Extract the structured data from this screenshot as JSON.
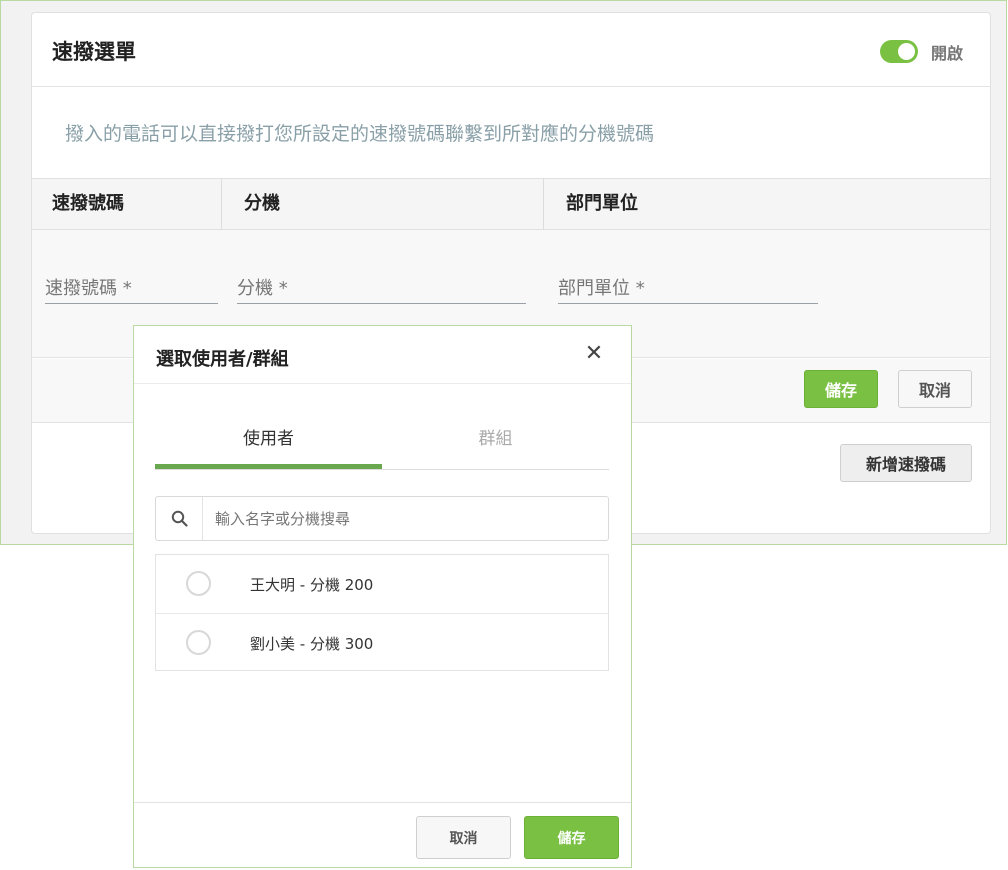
{
  "speed_dial": {
    "title": "速撥選單",
    "toggle_label": "開啟",
    "description": "撥入的電話可以直接撥打您所設定的速撥號碼聯繫到所對應的分機號碼",
    "columns": [
      "速撥號碼",
      "分機",
      "部門單位"
    ],
    "fields": {
      "speed_dial_placeholder": "速撥號碼 *",
      "extension_placeholder": "分機 *",
      "department_placeholder": "部門單位 *"
    },
    "save_label": "儲存",
    "cancel_label": "取消",
    "add_label": "新增速撥碼"
  },
  "modal": {
    "title": "選取使用者/群組",
    "close_glyph": "✕",
    "tabs": [
      "使用者",
      "群組"
    ],
    "search_placeholder": "輸入名字或分機搜尋",
    "users": [
      "王大明 - 分機 200",
      "劉小美 - 分機 300"
    ],
    "cancel_label": "取消",
    "save_label": "儲存"
  },
  "colors": {
    "accent": "#7ac143",
    "frame_border": "#b9d9a3"
  },
  "icons": {
    "toggle": "toggle-switch-on",
    "search": "search-icon",
    "close": "close-icon"
  }
}
